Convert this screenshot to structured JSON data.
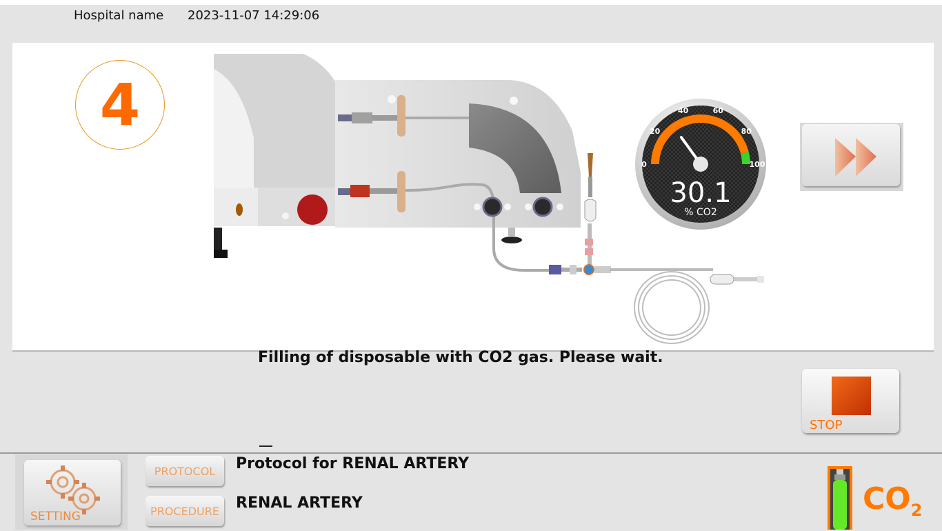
{
  "header": {
    "hospital_name": "Hospital name",
    "datetime": "2023-11-07 14:29:06"
  },
  "step": {
    "number": "4"
  },
  "gauge": {
    "value": "30.1",
    "value_numeric": 30.1,
    "unit": "% CO2",
    "ticks": [
      "0",
      "20",
      "40",
      "60",
      "80",
      "100"
    ],
    "scale_min": 0,
    "scale_max": 100
  },
  "status": {
    "message": "Filling of disposable with CO2 gas. Please wait."
  },
  "buttons": {
    "fast_forward_icon": "fast-forward-icon",
    "stop_label": "STOP",
    "setting_label": "SETTING",
    "protocol_label": "PROTOCOL",
    "procedure_label": "PROCEDURE"
  },
  "protocol": {
    "title": "Protocol for RENAL ARTERY",
    "procedure": "RENAL ARTERY"
  },
  "co2_indicator": {
    "label": "CO",
    "subscript": "2",
    "cylinder_color": "#66e82a",
    "accent": "#ff7a00"
  },
  "colors": {
    "accent_orange": "#ff6a00",
    "stop_red": "#d23a00"
  }
}
